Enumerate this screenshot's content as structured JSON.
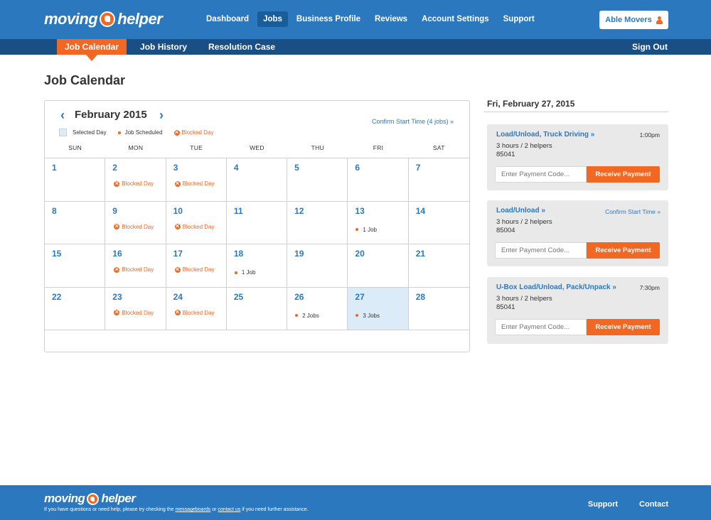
{
  "brand": {
    "logo_left": "moving",
    "logo_right": "helper"
  },
  "colors": {
    "brand_blue": "#2b78bf",
    "dark_blue": "#1a4f86",
    "accent_orange": "#f26722",
    "selected_day": "#dcebf8"
  },
  "header": {
    "nav": [
      "Dashboard",
      "Jobs",
      "Business Profile",
      "Reviews",
      "Account Settings",
      "Support"
    ],
    "active_nav": "Jobs",
    "account_button": "Able Movers",
    "account_icon": "person-icon"
  },
  "subnav": {
    "items": [
      "Job Calendar",
      "Job History",
      "Resolution Case"
    ],
    "active": "Job Calendar",
    "sign_out": "Sign Out"
  },
  "page_title": "Job Calendar",
  "calendar": {
    "month": "February 2015",
    "prev_icon": "chevron-left-icon",
    "next_icon": "chevron-right-icon",
    "confirm_link": "Confirm Start Time (4 jobs) »",
    "legend": {
      "selected": "Selected Day",
      "scheduled": "Job Scheduled",
      "blocked": "Blocked Day"
    },
    "weekdays": [
      "SUN",
      "MON",
      "TUE",
      "WED",
      "THU",
      "FRI",
      "SAT"
    ],
    "weeks": [
      [
        {
          "n": "1"
        },
        {
          "n": "2",
          "blocked": "Blocked Day"
        },
        {
          "n": "3",
          "blocked": "Blocked Day"
        },
        {
          "n": "4"
        },
        {
          "n": "5"
        },
        {
          "n": "6"
        },
        {
          "n": "7"
        }
      ],
      [
        {
          "n": "8"
        },
        {
          "n": "9",
          "blocked": "Blocked Day"
        },
        {
          "n": "10",
          "blocked": "Blocked Day"
        },
        {
          "n": "11"
        },
        {
          "n": "12"
        },
        {
          "n": "13",
          "jobs": "1 Job"
        },
        {
          "n": "14"
        }
      ],
      [
        {
          "n": "15"
        },
        {
          "n": "16",
          "blocked": "Blocked Day"
        },
        {
          "n": "17",
          "blocked": "Blocked Day"
        },
        {
          "n": "18",
          "jobs": "1 Job"
        },
        {
          "n": "19"
        },
        {
          "n": "20"
        },
        {
          "n": "21"
        }
      ],
      [
        {
          "n": "22"
        },
        {
          "n": "23",
          "blocked": "Blocked Day"
        },
        {
          "n": "24",
          "blocked": "Blocked Day"
        },
        {
          "n": "25"
        },
        {
          "n": "26",
          "jobs": "2 Jobs"
        },
        {
          "n": "27",
          "jobs": "3 Jobs",
          "selected": true
        },
        {
          "n": "28"
        }
      ]
    ]
  },
  "day_panel": {
    "date": "Fri, February 27, 2015",
    "jobs": [
      {
        "title": "Load/Unload, Truck Driving »",
        "time": "1:00pm",
        "confirm": "",
        "duration": "3 hours / 2 helpers",
        "zip": "85041",
        "input_placeholder": "Enter Payment Code...",
        "button": "Receive Payment"
      },
      {
        "title": "Load/Unload »",
        "time": "",
        "confirm": "Confirm Start Time »",
        "duration": "3 hours / 2 helpers",
        "zip": "85004",
        "input_placeholder": "Enter Payment Code...",
        "button": "Receive Payment"
      },
      {
        "title": "U-Box Load/Unload, Pack/Unpack »",
        "time": "7:30pm",
        "confirm": "",
        "duration": "3 hours / 2 helpers",
        "zip": "85041",
        "input_placeholder": "Enter Payment Code...",
        "button": "Receive Payment"
      }
    ]
  },
  "footer": {
    "help_prefix": "If you have questions or need help, please try checking the ",
    "messageboards": "messageboards",
    "help_or": " or ",
    "contact_us": "contact us",
    "help_suffix": " if you need further assistance.",
    "links": [
      "Support",
      "Contact"
    ]
  }
}
